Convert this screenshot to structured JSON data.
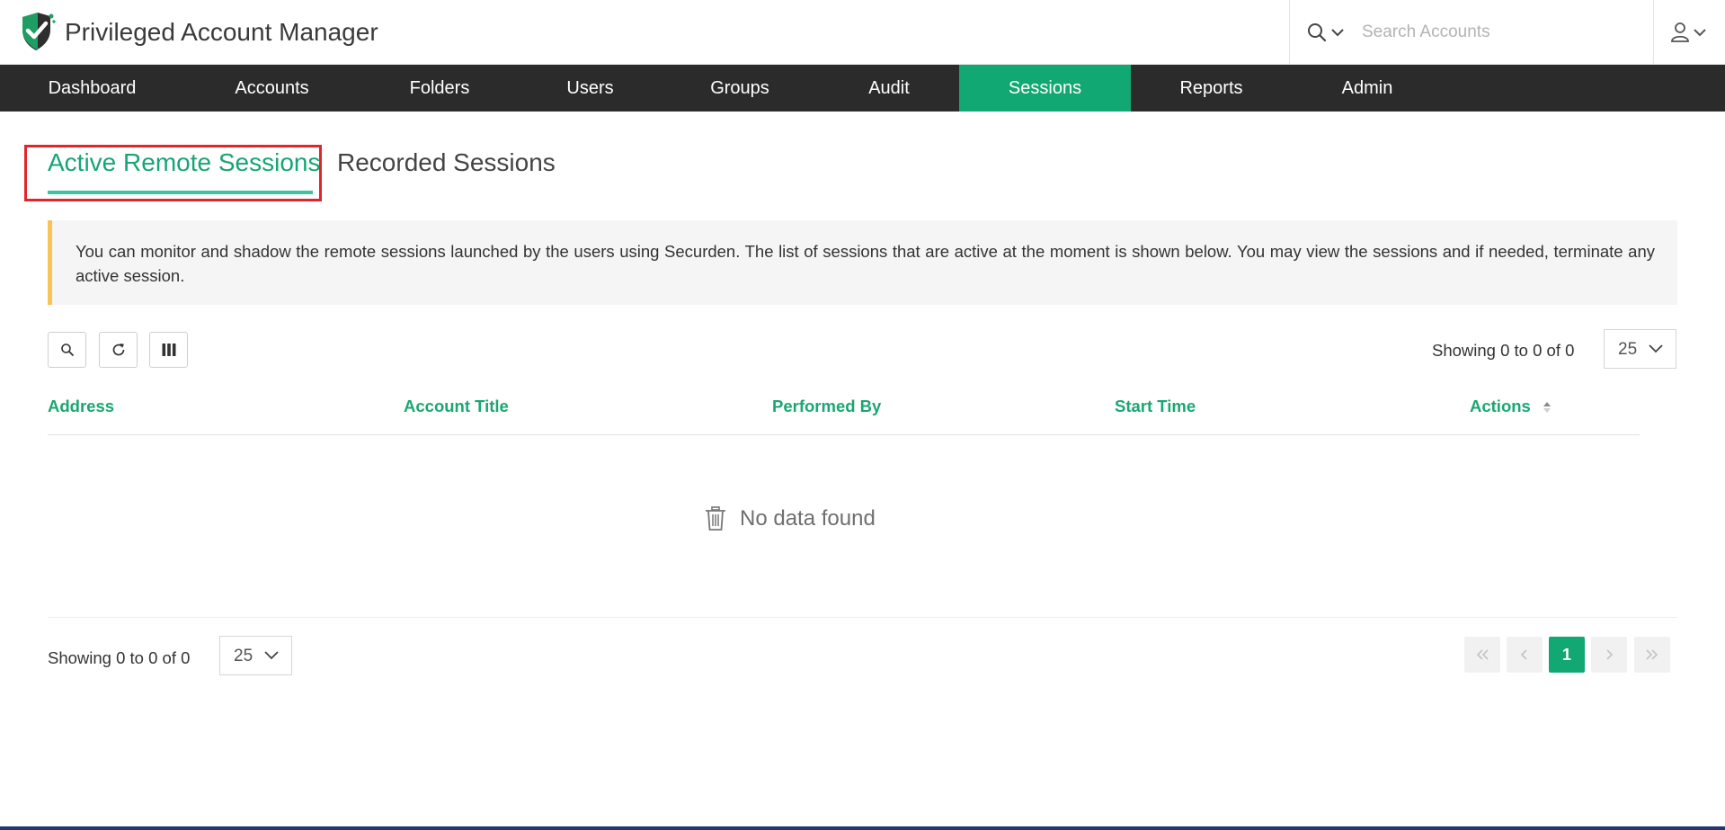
{
  "header": {
    "app_title": "Privileged Account Manager",
    "logo_icon": "shield-check-icon",
    "search": {
      "placeholder": "Search Accounts",
      "value": ""
    },
    "user_icon": "user-icon"
  },
  "nav": {
    "items": [
      {
        "label": "Dashboard"
      },
      {
        "label": "Accounts"
      },
      {
        "label": "Folders"
      },
      {
        "label": "Users"
      },
      {
        "label": "Groups"
      },
      {
        "label": "Audit"
      },
      {
        "label": "Sessions",
        "active": true
      },
      {
        "label": "Reports"
      },
      {
        "label": "Admin"
      }
    ]
  },
  "tabs": [
    {
      "label": "Active Remote Sessions",
      "active": true
    },
    {
      "label": "Recorded Sessions"
    }
  ],
  "info": {
    "text": "You can monitor and shadow the remote sessions launched by the users using Securden. The list of sessions that are active at the moment is shown below. You may view the sessions and if needed, terminate any active session."
  },
  "toolbar": {
    "search_icon": "search-icon",
    "refresh_icon": "refresh-icon",
    "columns_icon": "columns-icon",
    "showing_text": "Showing 0 to 0 of 0",
    "page_size": "25"
  },
  "table": {
    "columns": [
      "Address",
      "Account Title",
      "Performed By",
      "Start Time",
      "Actions"
    ],
    "rows": [],
    "empty_text": "No data found"
  },
  "footer": {
    "showing_text": "Showing 0 to 0 of 0",
    "page_size": "25",
    "current_page": "1"
  },
  "colors": {
    "accent": "#12a873",
    "nav_bg": "#2b2b2b",
    "highlight": "#e0262b",
    "info_border": "#f6c555"
  }
}
